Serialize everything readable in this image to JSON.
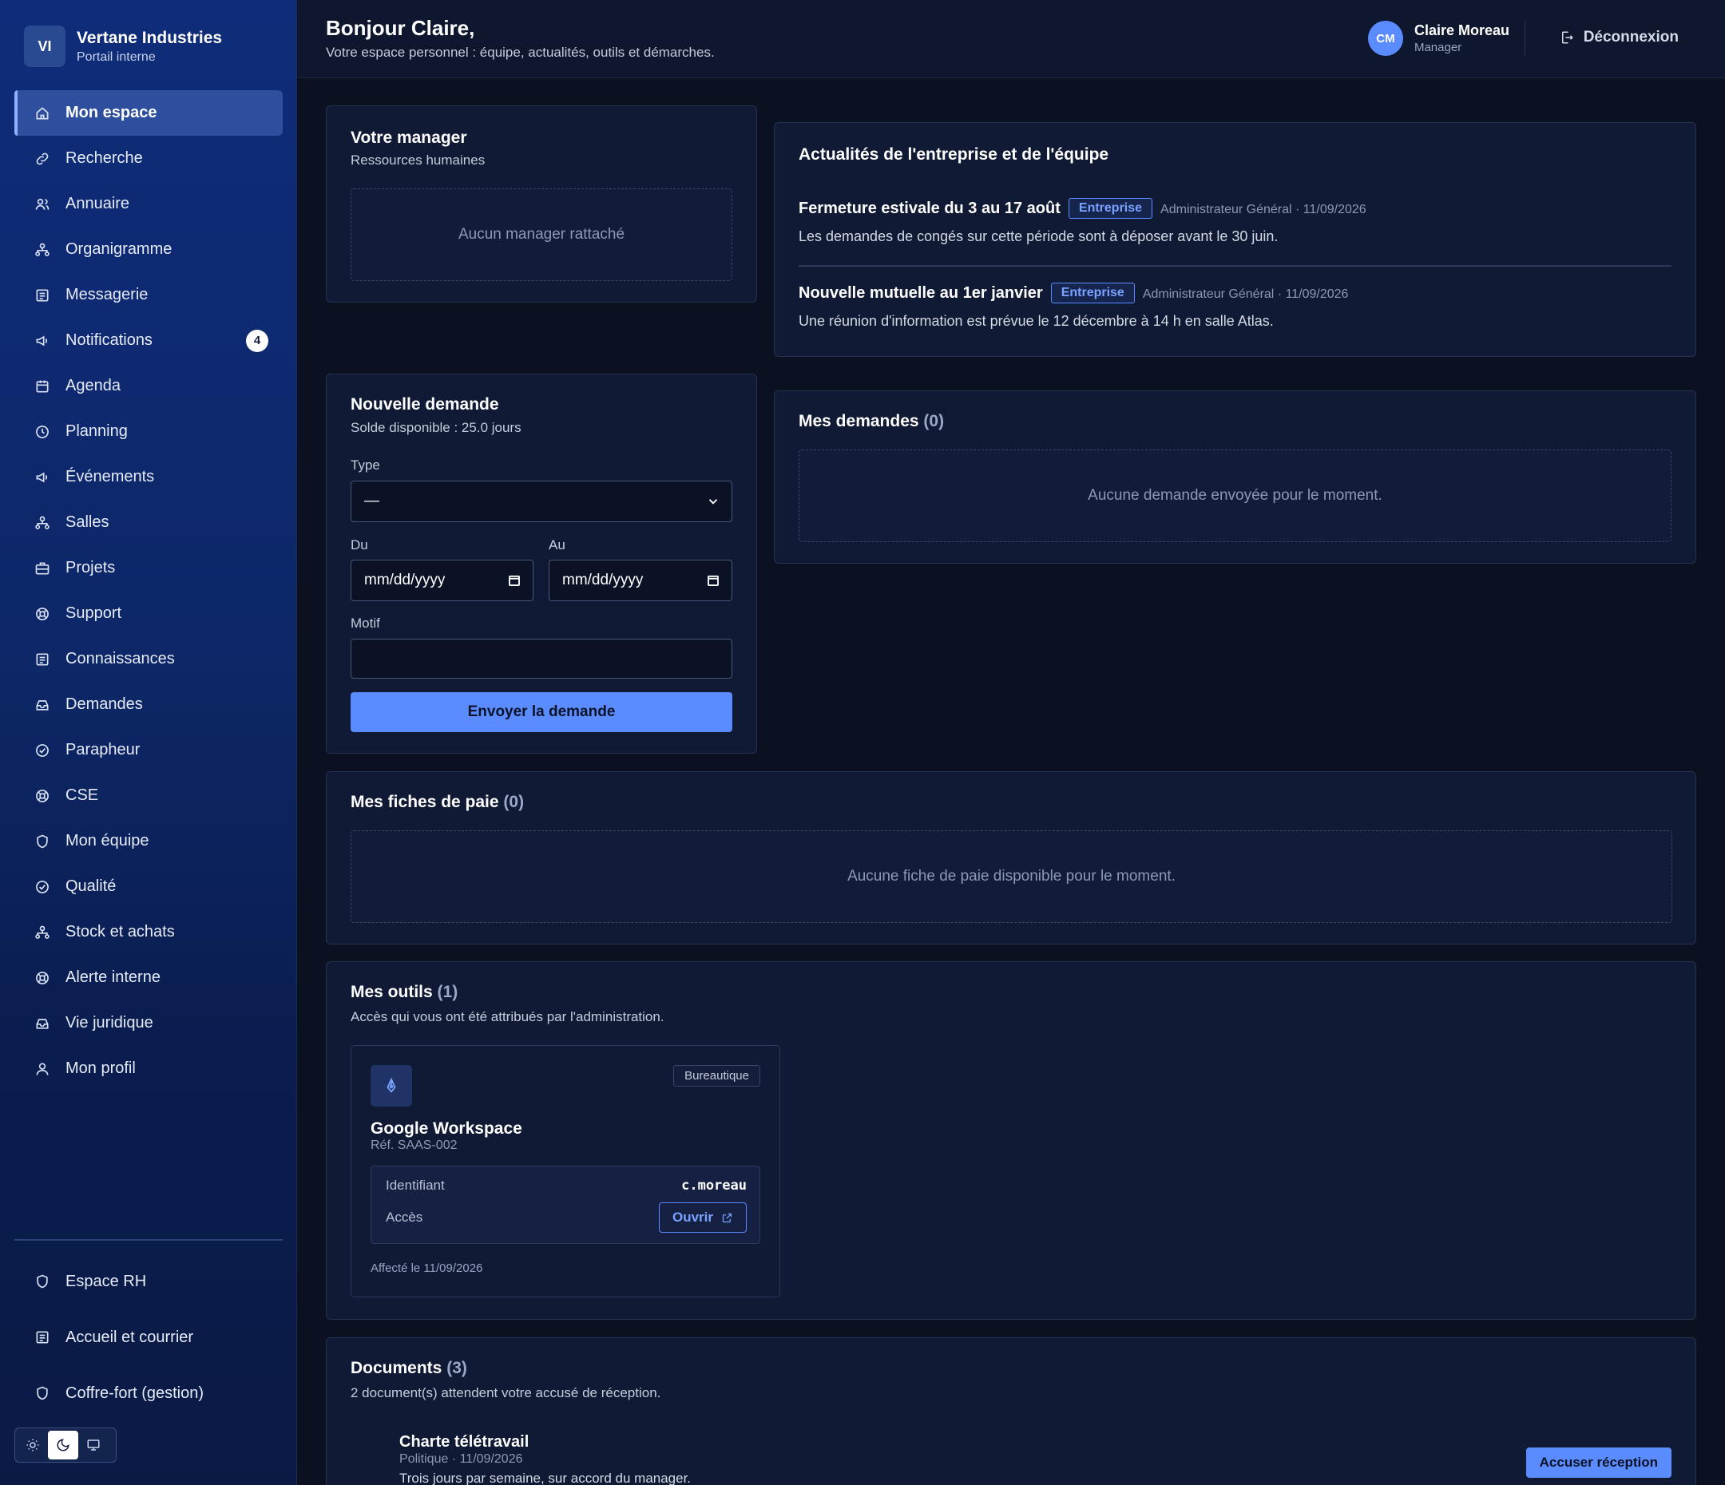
{
  "brand": {
    "initials": "VI",
    "name": "Vertane Industries",
    "subtitle": "Portail interne"
  },
  "sidebar": {
    "items": [
      {
        "label": "Mon espace",
        "icon": "home-icon",
        "active": true
      },
      {
        "label": "Recherche",
        "icon": "link-icon"
      },
      {
        "label": "Annuaire",
        "icon": "users-icon"
      },
      {
        "label": "Organigramme",
        "icon": "org-chart-icon"
      },
      {
        "label": "Messagerie",
        "icon": "document-icon"
      },
      {
        "label": "Notifications",
        "icon": "megaphone-icon",
        "badge": "4"
      },
      {
        "label": "Agenda",
        "icon": "calendar-icon"
      },
      {
        "label": "Planning",
        "icon": "clock-icon"
      },
      {
        "label": "Événements",
        "icon": "megaphone-icon"
      },
      {
        "label": "Salles",
        "icon": "org-chart-icon"
      },
      {
        "label": "Projets",
        "icon": "briefcase-icon"
      },
      {
        "label": "Support",
        "icon": "lifebuoy-icon"
      },
      {
        "label": "Connaissances",
        "icon": "document-icon"
      },
      {
        "label": "Demandes",
        "icon": "inbox-icon"
      },
      {
        "label": "Parapheur",
        "icon": "check-circle-icon"
      },
      {
        "label": "CSE",
        "icon": "lifebuoy-icon"
      },
      {
        "label": "Mon équipe",
        "icon": "shield-icon"
      },
      {
        "label": "Qualité",
        "icon": "check-circle-icon"
      },
      {
        "label": "Stock et achats",
        "icon": "org-chart-icon"
      },
      {
        "label": "Alerte interne",
        "icon": "lifebuoy-icon"
      },
      {
        "label": "Vie juridique",
        "icon": "inbox-icon"
      },
      {
        "label": "Mon profil",
        "icon": "user-icon"
      }
    ],
    "bottom_items": [
      {
        "label": "Espace RH",
        "icon": "shield-icon"
      },
      {
        "label": "Accueil et courrier",
        "icon": "document-icon"
      },
      {
        "label": "Coffre-fort (gestion)",
        "icon": "shield-icon"
      }
    ],
    "theme": {
      "options": [
        "light",
        "dark",
        "system"
      ],
      "selected": "dark"
    }
  },
  "header": {
    "greeting": "Bonjour Claire,",
    "subtitle": "Votre espace personnel : équipe, actualités, outils et démarches.",
    "user": {
      "initials": "CM",
      "name": "Claire Moreau",
      "role": "Manager"
    },
    "logout_label": "Déconnexion"
  },
  "manager_card": {
    "title": "Votre manager",
    "subtitle": "Ressources humaines",
    "empty": "Aucun manager rattaché"
  },
  "news": {
    "title": "Actualités de l'entreprise et de l'équipe",
    "items": [
      {
        "title": "Fermeture estivale du 3 au 17 août",
        "tag": "Entreprise",
        "meta": "Administrateur Général · 11/09/2026",
        "body": "Les demandes de congés sur cette période sont à déposer avant le 30 juin."
      },
      {
        "title": "Nouvelle mutuelle au 1er janvier",
        "tag": "Entreprise",
        "meta": "Administrateur Général · 11/09/2026",
        "body": "Une réunion d'information est prévue le 12 décembre à 14 h en salle Atlas."
      }
    ]
  },
  "new_request": {
    "title": "Nouvelle demande",
    "balance": "Solde disponible : 25.0 jours",
    "type_label": "Type",
    "type_value": "—",
    "from_label": "Du",
    "from_value": "mm/dd/yyyy",
    "to_label": "Au",
    "to_value": "mm/dd/yyyy",
    "reason_label": "Motif",
    "reason_value": "",
    "submit_label": "Envoyer la demande"
  },
  "my_requests": {
    "title": "Mes demandes",
    "count": "(0)",
    "empty": "Aucune demande envoyée pour le moment."
  },
  "payslips": {
    "title": "Mes fiches de paie",
    "count": "(0)",
    "empty": "Aucune fiche de paie disponible pour le moment."
  },
  "tools": {
    "title": "Mes outils",
    "count": "(1)",
    "subtitle": "Accès qui vous ont été attribués par l'administration.",
    "items": [
      {
        "icon": "pen-tool-icon",
        "category": "Bureautique",
        "name": "Google Workspace",
        "ref": "Réf. SAAS-002",
        "id_label": "Identifiant",
        "id_value": "c.moreau",
        "access_label": "Accès",
        "open_label": "Ouvrir",
        "assigned": "Affecté le 11/09/2026"
      }
    ]
  },
  "documents": {
    "title": "Documents",
    "count": "(3)",
    "subtitle": "2 document(s) attendent votre accusé de réception.",
    "items": [
      {
        "title": "Charte télétravail",
        "meta": "Politique · 11/09/2026",
        "desc": "Trois jours par semaine, sur accord du manager.",
        "action": "Accuser réception"
      }
    ]
  }
}
